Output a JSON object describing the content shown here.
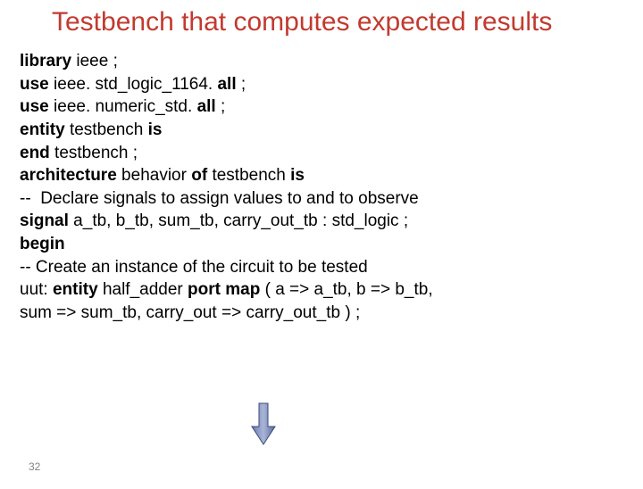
{
  "title": "Testbench that computes expected results",
  "lines": {
    "l1a": "library",
    "l1b": " ieee ;",
    "l2a": "use",
    "l2b": " ieee. std_logic_1164. ",
    "l2c": "all",
    "l2d": " ;",
    "l3a": "use",
    "l3b": " ieee. numeric_std. ",
    "l3c": "all",
    "l3d": " ;",
    "l4a": "entity",
    "l4b": " testbench ",
    "l4c": "is",
    "l5a": "end",
    "l5b": " testbench ;",
    "l6a": "architecture",
    "l6b": " behavior ",
    "l6c": "of",
    "l6d": " testbench ",
    "l6e": "is",
    "l7": "--  Declare signals to assign values to and to observe",
    "l8a": "signal",
    "l8b": " a_tb, b_tb, sum_tb, carry_out_tb : std_logic ;",
    "l9": "begin",
    "l10": "-- Create an instance of the circuit to be tested",
    "l11a": "uut: ",
    "l11b": "entity",
    "l11c": " half_adder ",
    "l11d": "port map",
    "l11e": " ( a => a_tb, b => b_tb,",
    "l12": "sum => sum_tb, carry_out => carry_out_tb ) ;"
  },
  "pageNumber": "32"
}
